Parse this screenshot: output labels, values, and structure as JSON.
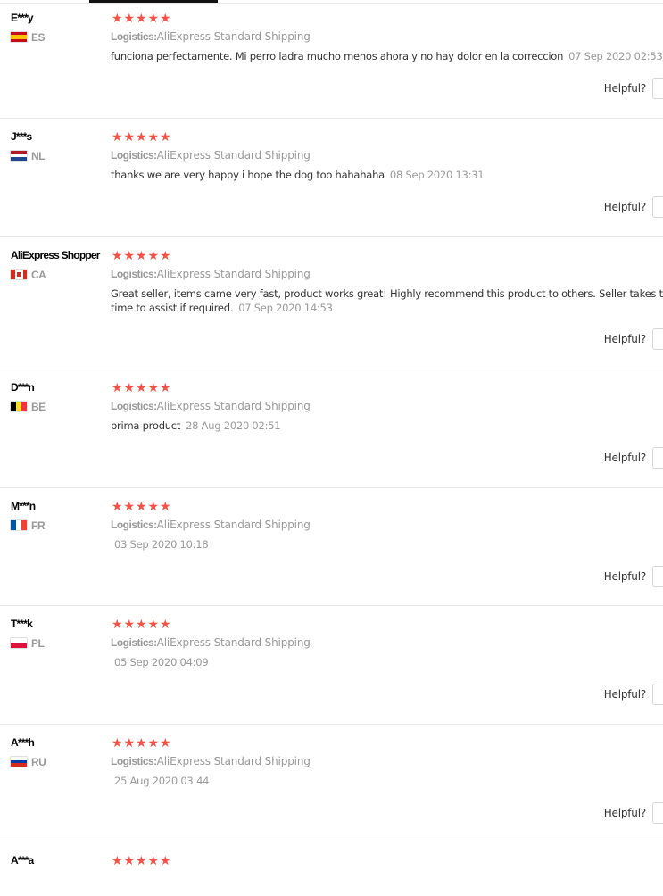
{
  "reviews": [
    {
      "user": "E***y",
      "country": "ES",
      "flag": "es",
      "rating": 5,
      "logistics_label": "Logistics:",
      "logistics_value": "AliExpress Standard Shipping",
      "feedback": "funciona perfectamente. Mi perro ladra mucho menos ahora y no hay dolor en la correccion",
      "date": "07 Sep 2020 02:53",
      "helpful_label": "Helpful?"
    },
    {
      "user": "J***s",
      "country": "NL",
      "flag": "nl",
      "rating": 5,
      "logistics_label": "Logistics:",
      "logistics_value": "AliExpress Standard Shipping",
      "feedback": "thanks we are very happy i hope the dog too hahahaha",
      "date": "08 Sep 2020 13:31",
      "helpful_label": "Helpful?"
    },
    {
      "user": "AliExpress Shopper",
      "country": "CA",
      "flag": "ca",
      "rating": 5,
      "logistics_label": "Logistics:",
      "logistics_value": "AliExpress Standard Shipping",
      "feedback": "Great seller, items came very fast, product works great! Highly recommend this product to others. Seller takes the time to assist if required.",
      "date": "07 Sep 2020 14:53",
      "helpful_label": "Helpful?"
    },
    {
      "user": "D***n",
      "country": "BE",
      "flag": "be",
      "rating": 5,
      "logistics_label": "Logistics:",
      "logistics_value": "AliExpress Standard Shipping",
      "feedback": "prima product",
      "date": "28 Aug 2020 02:51",
      "helpful_label": "Helpful?"
    },
    {
      "user": "M***n",
      "country": "FR",
      "flag": "fr",
      "rating": 5,
      "logistics_label": "Logistics:",
      "logistics_value": "AliExpress Standard Shipping",
      "feedback": "",
      "date": "03 Sep 2020 10:18",
      "helpful_label": "Helpful?"
    },
    {
      "user": "T***k",
      "country": "PL",
      "flag": "pl",
      "rating": 5,
      "logistics_label": "Logistics:",
      "logistics_value": "AliExpress Standard Shipping",
      "feedback": "",
      "date": "05 Sep 2020 04:09",
      "helpful_label": "Helpful?"
    },
    {
      "user": "A***h",
      "country": "RU",
      "flag": "ru",
      "rating": 5,
      "logistics_label": "Logistics:",
      "logistics_value": "AliExpress Standard Shipping",
      "feedback": "",
      "date": "25 Aug 2020 03:44",
      "helpful_label": "Helpful?"
    },
    {
      "user": "A***a",
      "country": "",
      "flag": "",
      "rating": 5,
      "logistics_label": "",
      "logistics_value": "",
      "feedback": "",
      "date": "",
      "helpful_label": ""
    }
  ],
  "colors": {
    "star": "#f55145",
    "muted": "#999999",
    "text": "#333333",
    "divider": "#e8e8e8"
  }
}
